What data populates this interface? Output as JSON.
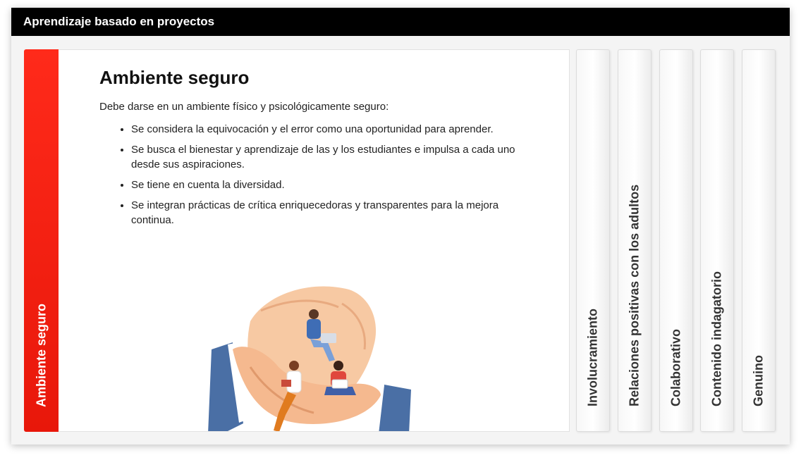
{
  "window": {
    "title": "Aprendizaje basado en proyectos"
  },
  "active_tab": {
    "label": "Ambiente seguro"
  },
  "content": {
    "heading": "Ambiente seguro",
    "intro": "Debe darse en un ambiente físico y psicológicamente seguro:",
    "bullets": [
      "Se considera la equivocación y el error como una oportunidad para aprender.",
      "Se busca el bienestar y aprendizaje de las y los estudiantes e impulsa a cada uno desde sus aspiraciones.",
      "Se tiene en cuenta la diversidad.",
      "Se integran prácticas de crítica enriquecedoras y transparentes para la mejora continua."
    ]
  },
  "tabs": [
    {
      "label": "Involucramiento"
    },
    {
      "label": "Relaciones positivas con los adultos"
    },
    {
      "label": "Colaborativo"
    },
    {
      "label": "Contenido indagatorio"
    },
    {
      "label": "Genuino"
    }
  ],
  "colors": {
    "accent": "#f0200f",
    "titlebar": "#000000"
  },
  "icons": {
    "illustration": "hands-holding-students-illustration"
  }
}
